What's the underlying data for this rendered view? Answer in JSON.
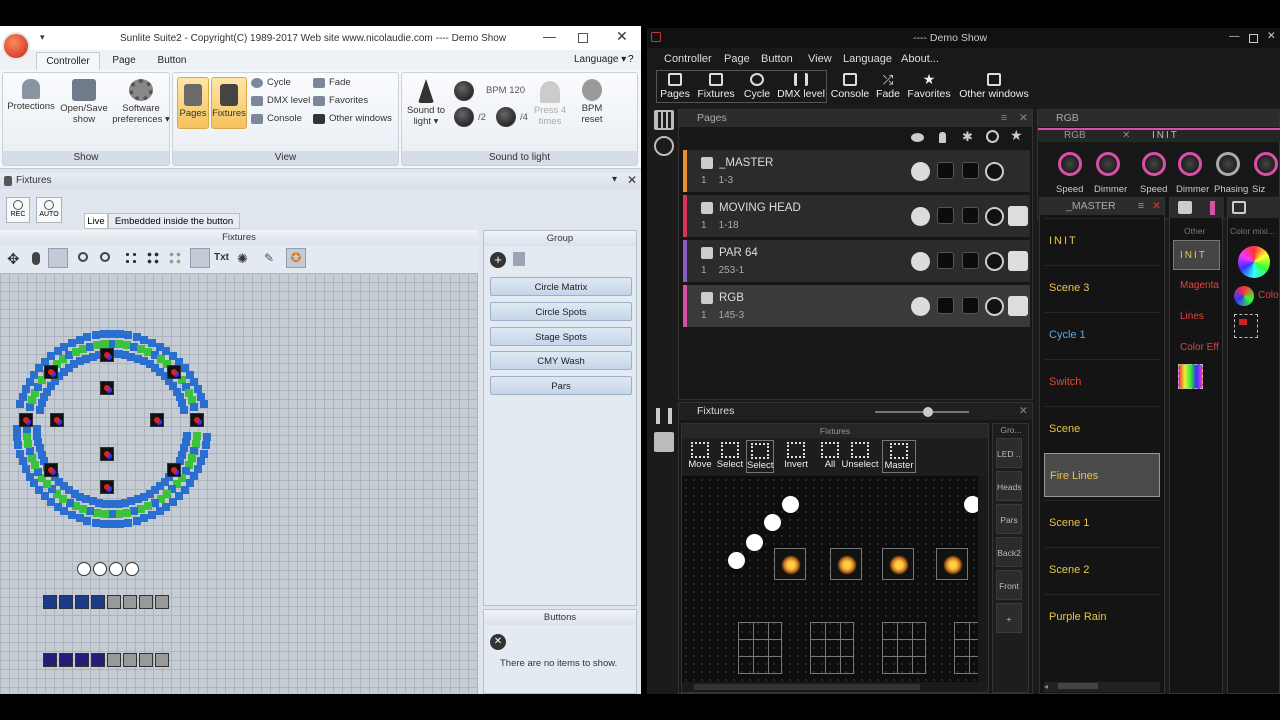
{
  "left": {
    "title": "Sunlite Suite2 - Copyright(C) 1989-2017     Web site www.nicolaudie.com ---- Demo Show",
    "tabs": [
      "Controller",
      "Page",
      "Button"
    ],
    "language": "Language",
    "help": "?",
    "groups": {
      "show": {
        "label": "Show",
        "buttons": [
          "Protections",
          "Open/Save show",
          "Software preferences"
        ]
      },
      "view": {
        "label": "View",
        "big": [
          "Pages",
          "Fixtures"
        ],
        "small": [
          "Cycle",
          "DMX level",
          "Console",
          "Fade",
          "Favorites",
          "Other windows"
        ]
      },
      "sound": {
        "label": "Sound to light",
        "sound_btn": "Sound to light",
        "bpm": "BPM 120",
        "div2": "/2",
        "div4": "/4",
        "press": "Press 4 times",
        "reset": "BPM reset"
      }
    },
    "fixtures_window": {
      "title": "Fixtures",
      "rec": "REC",
      "auto": "AUTO",
      "tabs": [
        "Live",
        "Embedded inside the button"
      ],
      "panel_title": "Fixtures",
      "group_title": "Group",
      "groups": [
        "Circle Matrix",
        "Circle Spots",
        "Stage Spots",
        "CMY Wash",
        "Pars"
      ],
      "buttons_title": "Buttons",
      "buttons_empty": "There are no items to show."
    }
  },
  "right": {
    "title": "---- Demo Show",
    "menu": [
      "Controller",
      "Page",
      "Button",
      "View",
      "Language",
      "About..."
    ],
    "toolbar": [
      "Pages",
      "Fixtures",
      "Cycle",
      "DMX level",
      "Console",
      "Fade",
      "Favorites",
      "Other windows"
    ],
    "pages": {
      "title": "Pages",
      "rows": [
        {
          "name": "_MASTER",
          "num": "1",
          "range": "1-3",
          "color": "#e8912c"
        },
        {
          "name": "MOVING HEAD",
          "num": "1",
          "range": "1-18",
          "color": "#d8335a"
        },
        {
          "name": "PAR 64",
          "num": "1",
          "range": "253-1",
          "color": "#8a5cc8"
        },
        {
          "name": "RGB",
          "num": "1",
          "range": "145-3",
          "color": "#d94fa8"
        }
      ]
    },
    "rgb": {
      "title": "RGB",
      "sub1": "RGB",
      "sub2": "INIT",
      "knobs": [
        "Speed",
        "Dimmer",
        "Speed",
        "Dimmer",
        "Phasing",
        "Siz"
      ]
    },
    "master": {
      "title": "_MASTER",
      "items": [
        {
          "label": "INIT",
          "color": "#e9c44a"
        },
        {
          "label": "Scene 3",
          "color": "#e9c44a"
        },
        {
          "label": "Cycle 1",
          "color": "#5aa7e8"
        },
        {
          "label": "Switch",
          "color": "#e0453a"
        },
        {
          "label": "Scene",
          "color": "#e9c44a"
        },
        {
          "label": "Fire Lines",
          "color": "#e9c44a"
        },
        {
          "label": "Scene 1",
          "color": "#e9c44a"
        },
        {
          "label": "Scene 2",
          "color": "#e9c44a"
        },
        {
          "label": "Purple Rain",
          "color": "#e9c44a"
        }
      ]
    },
    "rgbpanel": {
      "other": "Other",
      "colormix": "Color mixi...",
      "items": [
        "INIT",
        "Magenta",
        "Lines",
        "Color Eff..."
      ],
      "colo": "Colo"
    },
    "fixtures": {
      "title": "Fixtures",
      "sub": "Fixtures",
      "grp": "Gro...",
      "tools": [
        "Move",
        "Select",
        "Select",
        "Invert",
        "All",
        "Unselect",
        "Master"
      ],
      "groups": [
        "LED ...",
        "Heads",
        "Pars",
        "Back2",
        "Front",
        "+"
      ]
    }
  }
}
